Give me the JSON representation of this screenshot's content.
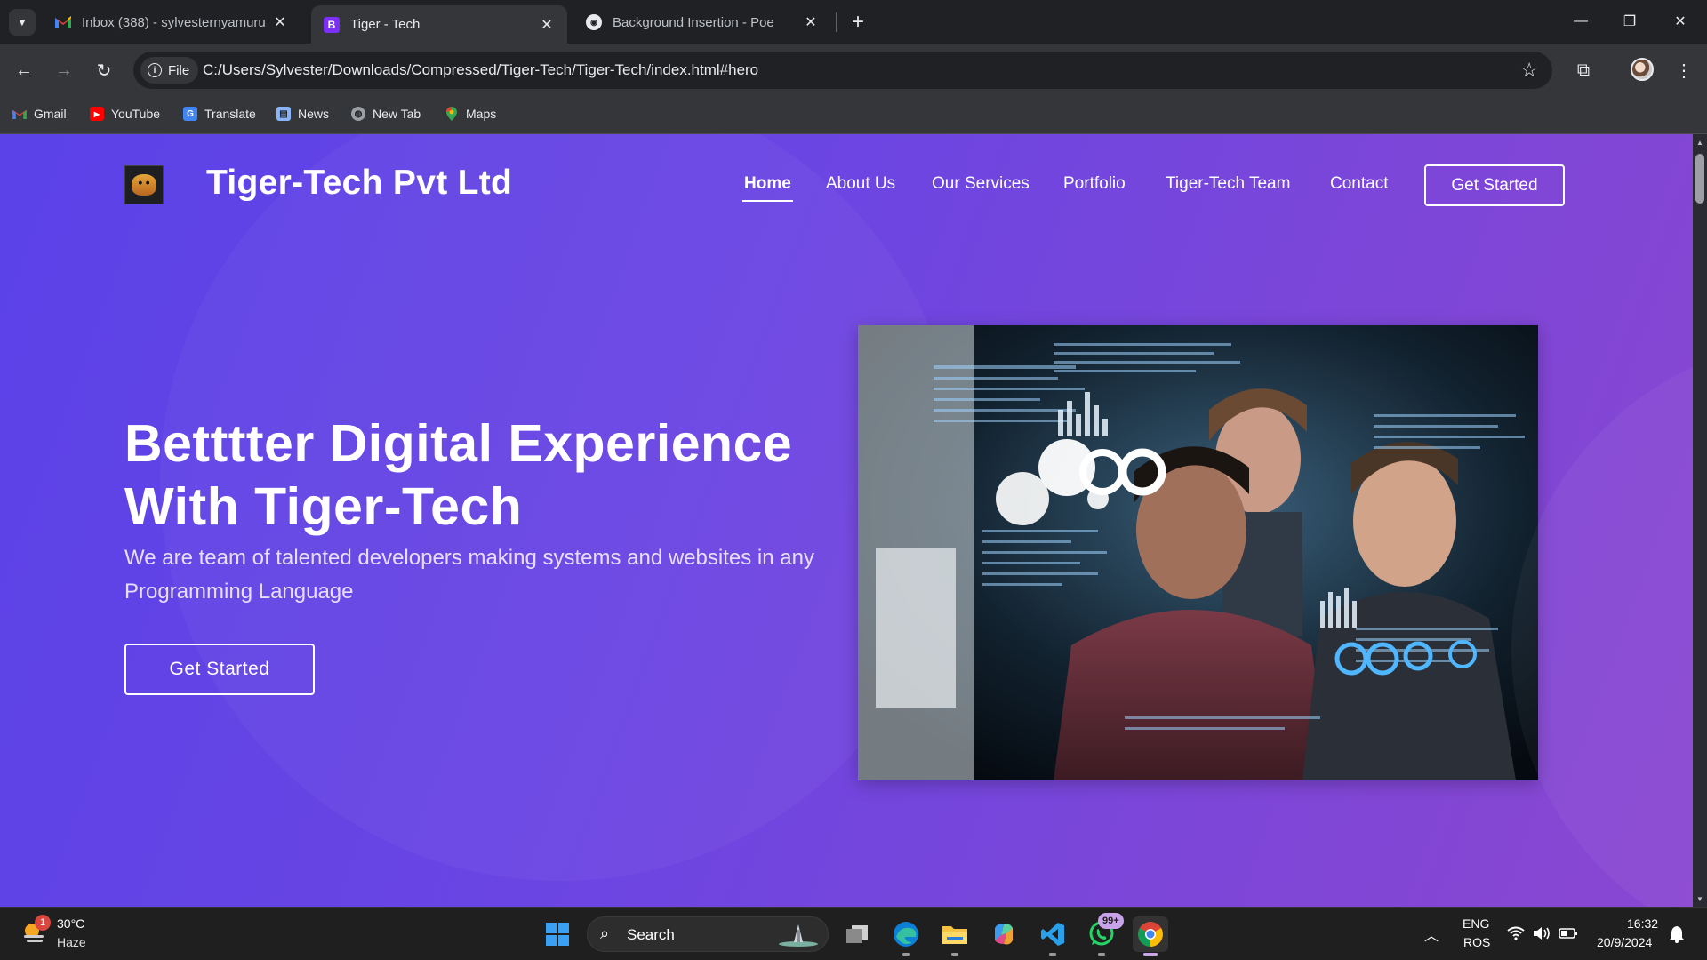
{
  "browser": {
    "tabs": [
      {
        "title": "Inbox (388) - sylvesternyamuru",
        "favicon": "gmail-icon",
        "active": false
      },
      {
        "title": "Tiger - Tech",
        "favicon": "bootstrap-icon",
        "active": true
      },
      {
        "title": "Background Insertion - Poe",
        "favicon": "poe-icon",
        "active": false
      }
    ],
    "address_chip": "File",
    "url": "C:/Users/Sylvester/Downloads/Compressed/Tiger-Tech/Tiger-Tech/index.html#hero",
    "bookmarks": [
      "Gmail",
      "YouTube",
      "Translate",
      "News",
      "New Tab",
      "Maps"
    ]
  },
  "site": {
    "brand": "Tiger-Tech Pvt Ltd",
    "nav": [
      {
        "label": "Home",
        "active": true
      },
      {
        "label": "About Us",
        "active": false
      },
      {
        "label": "Our Services",
        "active": false
      },
      {
        "label": "Portfolio",
        "active": false
      },
      {
        "label": "Tiger-Tech Team",
        "active": false
      },
      {
        "label": "Contact",
        "active": false
      }
    ],
    "header_cta": "Get Started",
    "hero": {
      "title_line1": "Betttter Digital Experience",
      "title_line2": "With Tiger-Tech",
      "subtitle": "We are team of talented developers making systems and websites in any Programming Language",
      "cta": "Get Started"
    },
    "colors": {
      "gradient_start": "#5a42e8",
      "gradient_end": "#8a47d1",
      "text": "#ffffff"
    }
  },
  "taskbar": {
    "weather": {
      "temp": "30°C",
      "condition": "Haze",
      "badge": "1"
    },
    "search_label": "Search",
    "apps": [
      "windows-start-icon",
      "task-view-icon",
      "edge-icon",
      "file-explorer-icon",
      "copilot-icon",
      "vscode-icon",
      "whatsapp-icon",
      "chrome-icon"
    ],
    "whatsapp_badge": "99+",
    "lang_top": "ENG",
    "lang_bottom": "ROS",
    "time": "16:32",
    "date": "20/9/2024"
  }
}
